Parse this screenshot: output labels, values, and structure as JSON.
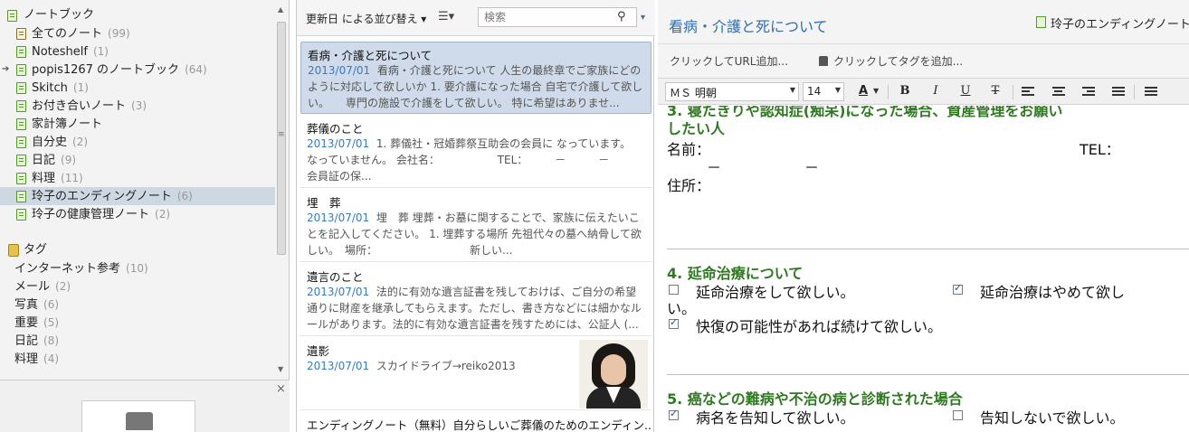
{
  "sidebar": {
    "notebooks_header": "ノートブック",
    "notebooks": [
      {
        "label": "全てのノート",
        "count": "(99)"
      },
      {
        "label": "Noteshelf",
        "count": "(1)"
      },
      {
        "label": "popis1267 のノートブック",
        "count": "(64)"
      },
      {
        "label": "Skitch",
        "count": "(1)"
      },
      {
        "label": "お付き合いノート",
        "count": "(3)"
      },
      {
        "label": "家計簿ノート",
        "count": ""
      },
      {
        "label": "自分史",
        "count": "(2)"
      },
      {
        "label": "日記",
        "count": "(9)"
      },
      {
        "label": "料理",
        "count": "(11)"
      },
      {
        "label": "玲子のエンディングノート",
        "count": "(6)"
      },
      {
        "label": "玲子の健康管理ノート",
        "count": "(2)"
      }
    ],
    "tags_header": "タグ",
    "tags": [
      {
        "label": "インターネット参考",
        "count": "(10)"
      },
      {
        "label": "メール",
        "count": "(2)"
      },
      {
        "label": "写真",
        "count": "(6)"
      },
      {
        "label": "重要",
        "count": "(5)"
      },
      {
        "label": "日記",
        "count": "(8)"
      },
      {
        "label": "料理",
        "count": "(4)"
      }
    ],
    "close_glyph": "×"
  },
  "notelist": {
    "sort_label": "更新日 による並び替え ▾",
    "view_label": "☰▾",
    "search_placeholder": "検索",
    "notes": [
      {
        "title": "看病・介護と死について",
        "date": "2013/07/01",
        "snippet": "看病・介護と死について 人生の最終章でご家族にどのように対応して欲しいか 1. 要介護になった場合 自宅で介護して欲しい。　　専門の施設で介護をして欲しい。 特に希望はありませ..."
      },
      {
        "title": "葬儀のこと",
        "date": "2013/07/01",
        "snippet": "1. 葬儀社・冠婚葬祭互助会の会員に なっています。　　　なっていません。 会社名： 　　　　　TEL：　　　－　　　－　　　　会員証の保..."
      },
      {
        "title": "埋　葬",
        "date": "2013/07/01",
        "snippet": "埋　葬 埋葬・お墓に関することで、家族に伝えたいことを記入してください。 1. 埋葬する場所 先祖代々の墓へ納骨して欲しい。　場所：　　　　　　　　　新しい..."
      },
      {
        "title": "遺言のこと",
        "date": "2013/07/01",
        "snippet": "法的に有効な遺言証書を残しておけば、ご自分の希望通りに財産を継承してもらえます。ただし、書き方などには細かなルールがあります。法的に有効な遺言証書を残すためには、公証人 (..."
      },
      {
        "title": "遺影",
        "date": "2013/07/01",
        "snippet": "スカイドライブ→reiko2013"
      },
      {
        "title": "エンディングノート（無料）自分らしいご葬儀のためのエンディン...",
        "date": "",
        "snippet": ""
      }
    ]
  },
  "editor": {
    "title": "看病・介護と死について",
    "notebook": "玲子のエンディングノート",
    "url_placeholder": "クリックしてURL追加...",
    "tag_placeholder": "クリックしてタグを追加...",
    "font": "ＭＳ 明朝",
    "size": "14",
    "format_buttons": {
      "color": "A",
      "bold": "B",
      "italic": "I",
      "underline": "U",
      "strike": "T"
    },
    "content": {
      "sec3_line1": "3. 寝たきりや認知症(痴呆)になった場合、資産管理をお願い",
      "sec3_line2": "したい人",
      "name_label": "名前：",
      "tel_label": "TEL：",
      "dash1": "－",
      "dash2": "－",
      "address_label": "住所：",
      "sec4_title": "4. 延命治療について",
      "sec4_opt1": "延命治療をして欲しい。",
      "sec4_opt2": "延命治療はやめて欲し",
      "sec4_opt2_wrap": "い。",
      "sec4_opt3": "快復の可能性があれば続けて欲しい。",
      "sec5_title": "5. 癌などの難病や不治の病と診断された場合",
      "sec5_opt1": "病名を告知して欲しい。",
      "sec5_opt2": "告知しないで欲しい。"
    },
    "checks": {
      "sec4_opt1": false,
      "sec4_opt2": true,
      "sec4_opt3": true,
      "sec5_opt1": true,
      "sec5_opt2": false
    }
  }
}
